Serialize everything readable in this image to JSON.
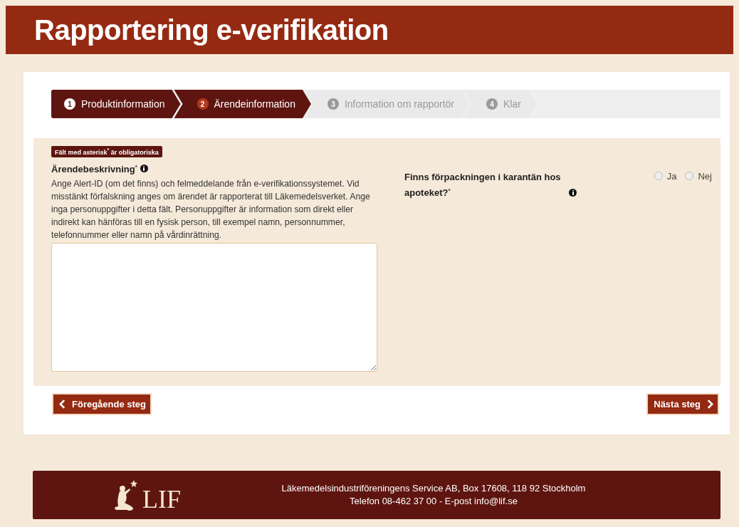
{
  "header": {
    "title": "Rapportering e-verifikation"
  },
  "steps": [
    {
      "number": "1",
      "label": "Produktinformation",
      "kind": "done"
    },
    {
      "number": "2",
      "label": "Ärendeinformation",
      "kind": "current"
    },
    {
      "number": "3",
      "label": "Information om rapportör",
      "kind": "upcoming"
    },
    {
      "number": "4",
      "label": "Klar",
      "kind": "upcoming"
    }
  ],
  "form": {
    "required_note": "Fält med asterisk$^{*}$ är obligatoriska",
    "description_field": {
      "label": "Ärendebeskrivning$^{*}$",
      "help": "Ange Alert-ID (om det finns) och felmeddelande från e-verifikationssystemet. Vid misstänkt förfalskning anges om ärendet är rapporterat till Läkemedelsverket. Ange inga personuppgifter i detta fält. Personuppgifter är information som direkt eller indirekt kan hänföras till en fysisk person, till exempel namn, personnummer, telefonnummer eller namn på vårdinrättning."
    },
    "quarantine_question": {
      "label": "Finns förpackningen i karantän hos apoteket?$^{*}$",
      "options": [
        {
          "label": "Ja",
          "checked": false
        },
        {
          "label": "Nej",
          "checked": false
        }
      ]
    }
  },
  "buttons": {
    "previous": "Föregående steg",
    "next": "Nästa steg"
  },
  "footer": {
    "logo_text": "LIF",
    "address": "Läkemedelsindustriföreningens Service AB, Box 17608, 118 92 Stockholm",
    "contact": "Telefon 08-462 37 00 - E-post info@lif.se"
  }
}
